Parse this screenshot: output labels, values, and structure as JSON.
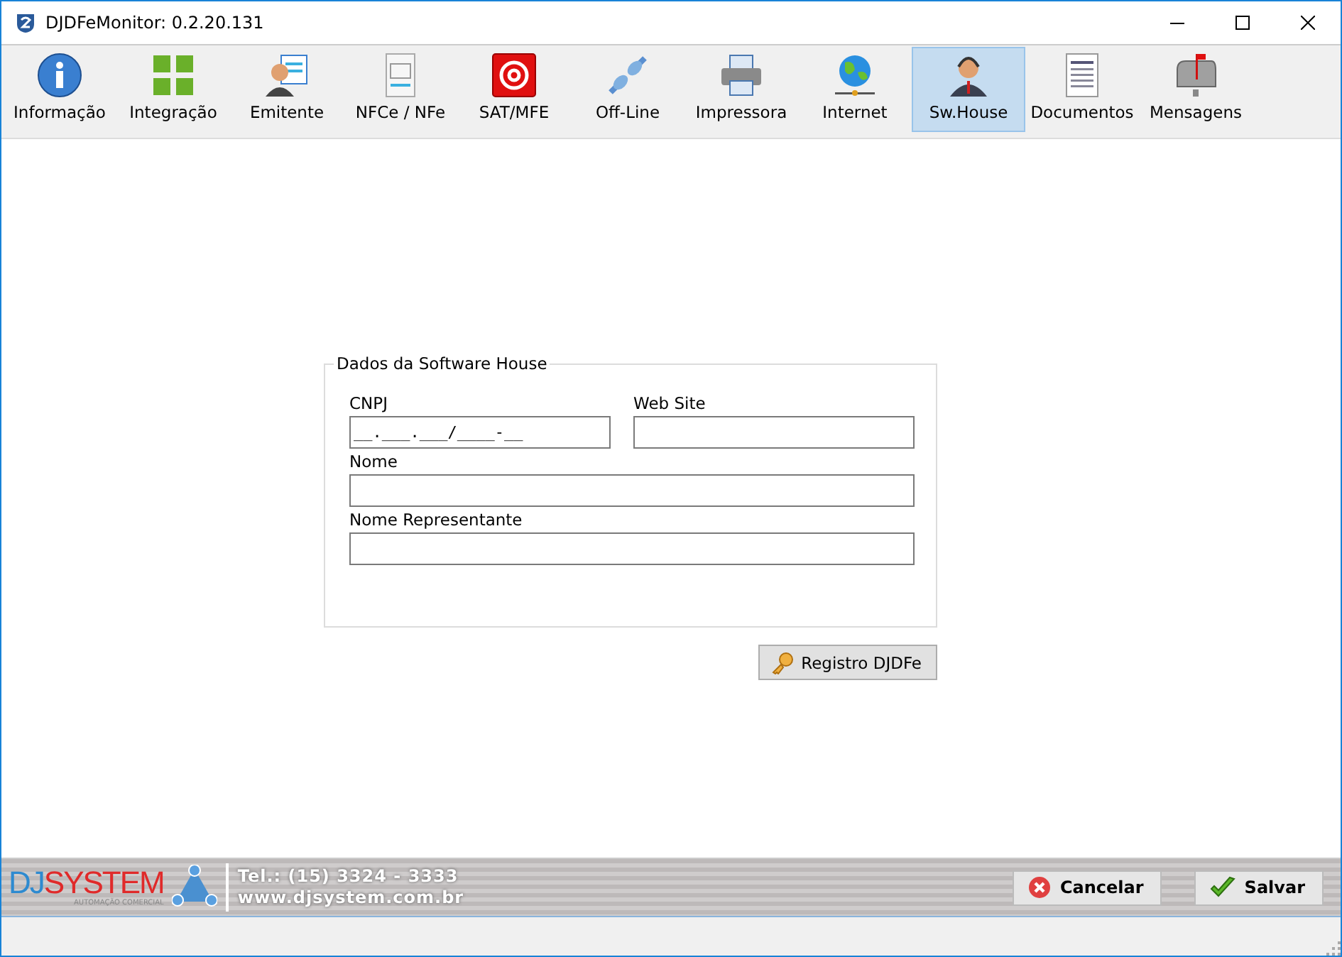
{
  "window": {
    "title": "DJDFeMonitor: 0.2.20.131"
  },
  "tabs": [
    {
      "label": "Informação",
      "selected": false
    },
    {
      "label": "Integração",
      "selected": false
    },
    {
      "label": "Emitente",
      "selected": false
    },
    {
      "label": "NFCe / NFe",
      "selected": false
    },
    {
      "label": "SAT/MFE",
      "selected": false
    },
    {
      "label": "Off-Line",
      "selected": false
    },
    {
      "label": "Impressora",
      "selected": false
    },
    {
      "label": "Internet",
      "selected": false
    },
    {
      "label": "Sw.House",
      "selected": true
    },
    {
      "label": "Documentos",
      "selected": false
    },
    {
      "label": "Mensagens",
      "selected": false
    }
  ],
  "group": {
    "title": "Dados da Software House",
    "fields": [
      {
        "label": "CNPJ",
        "value": "__.___.___/____-__"
      },
      {
        "label": "Web Site"
      },
      {
        "label": "Nome"
      },
      {
        "label": "Nome Representante"
      }
    ],
    "button": "Registro DJDFe"
  },
  "footer": {
    "logo_prefix": "DJ",
    "logo_name": "SYSTEM",
    "logo_tagline": "AUTOMAÇÃO COMERCIAL",
    "phone": "Tel.: (15) 3324 - 3333",
    "website": "www.djsystem.com.br",
    "buttons": [
      {
        "label": "Cancelar",
        "kind": "cancel"
      },
      {
        "label": "Salvar",
        "kind": "save"
      }
    ]
  }
}
